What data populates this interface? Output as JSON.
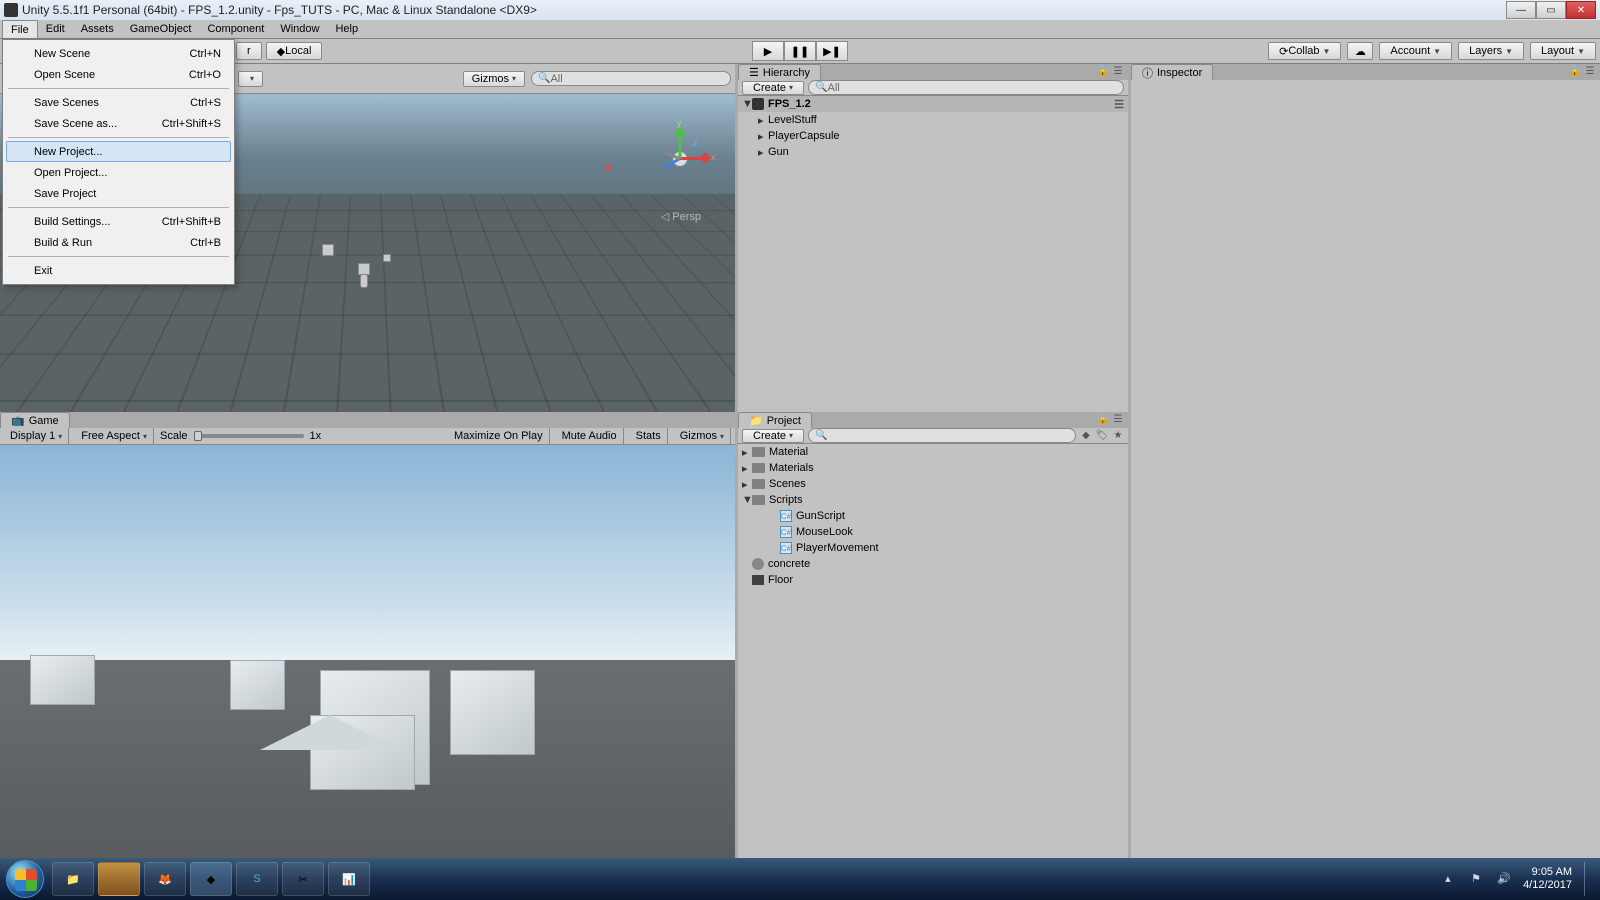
{
  "window": {
    "title": "Unity 5.5.1f1 Personal (64bit) - FPS_1.2.unity - Fps_TUTS - PC, Mac & Linux Standalone <DX9>"
  },
  "menubar": [
    "File",
    "Edit",
    "Assets",
    "GameObject",
    "Component",
    "Window",
    "Help"
  ],
  "file_menu": {
    "items": [
      {
        "label": "New Scene",
        "shortcut": "Ctrl+N"
      },
      {
        "label": "Open Scene",
        "shortcut": "Ctrl+O"
      },
      {
        "sep": true
      },
      {
        "label": "Save Scenes",
        "shortcut": "Ctrl+S"
      },
      {
        "label": "Save Scene as...",
        "shortcut": "Ctrl+Shift+S"
      },
      {
        "sep": true
      },
      {
        "label": "New Project...",
        "shortcut": "",
        "highlight": true
      },
      {
        "label": "Open Project...",
        "shortcut": ""
      },
      {
        "label": "Save Project",
        "shortcut": ""
      },
      {
        "sep": true
      },
      {
        "label": "Build Settings...",
        "shortcut": "Ctrl+Shift+B"
      },
      {
        "label": "Build & Run",
        "shortcut": "Ctrl+B"
      },
      {
        "sep": true
      },
      {
        "label": "Exit",
        "shortcut": ""
      }
    ]
  },
  "toolbar": {
    "pivot": "r",
    "local": "Local",
    "gizmos": "Gizmos",
    "search_prefix": "All",
    "collab": "Collab",
    "account": "Account",
    "layers": "Layers",
    "layout": "Layout"
  },
  "hierarchy": {
    "tab": "Hierarchy",
    "create": "Create",
    "search_prefix": "All",
    "scene": "FPS_1.2",
    "items": [
      "LevelStuff",
      "PlayerCapsule",
      "Gun"
    ]
  },
  "project": {
    "tab": "Project",
    "create": "Create",
    "folders": [
      "Material",
      "Materials",
      "Scenes",
      "Scripts"
    ],
    "scripts": [
      "GunScript",
      "MouseLook",
      "PlayerMovement"
    ],
    "assets": [
      {
        "name": "concrete",
        "kind": "material"
      },
      {
        "name": "Floor",
        "kind": "texture"
      }
    ]
  },
  "inspector": {
    "tab": "Inspector"
  },
  "scene": {
    "persp": "Persp"
  },
  "game": {
    "tab": "Game",
    "display": "Display 1",
    "aspect": "Free Aspect",
    "scale_label": "Scale",
    "scale_value": "1x",
    "maximize": "Maximize On Play",
    "mute": "Mute Audio",
    "stats": "Stats",
    "gizmos": "Gizmos"
  },
  "systray": {
    "time": "9:05 AM",
    "date": "4/12/2017"
  }
}
